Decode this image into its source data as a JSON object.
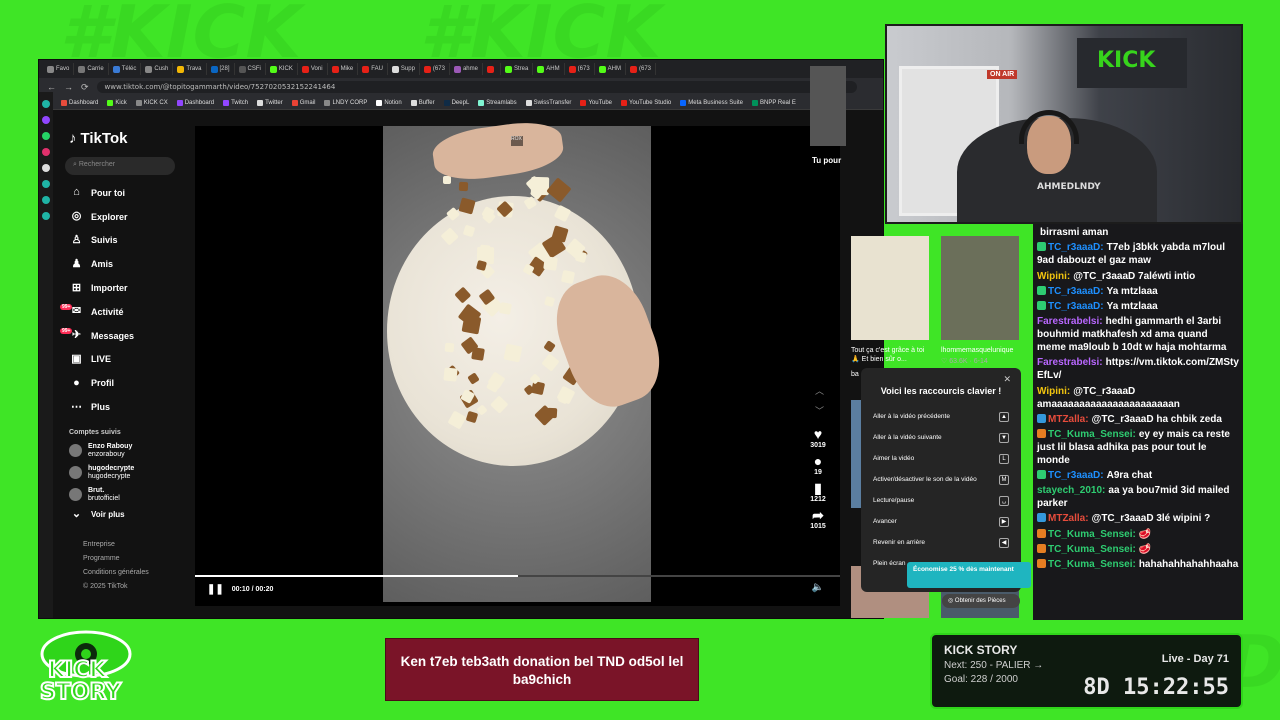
{
  "browser": {
    "tabs": [
      {
        "label": "Favo",
        "color": "#888888"
      },
      {
        "label": "Carrie",
        "color": "#777777"
      },
      {
        "label": "Téléc",
        "color": "#3a7bd5"
      },
      {
        "label": "Cush",
        "color": "#888888"
      },
      {
        "label": "Trava",
        "color": "#f2b705"
      },
      {
        "label": "[28]",
        "color": "#0a66c2"
      },
      {
        "label": "CSFi",
        "color": "#555555"
      },
      {
        "label": "KICK",
        "color": "#53fc18"
      },
      {
        "label": "Voni",
        "color": "#e62117"
      },
      {
        "label": "Mike",
        "color": "#e62117"
      },
      {
        "label": "FAU",
        "color": "#e62117"
      },
      {
        "label": "Supp",
        "color": "#dddddd"
      },
      {
        "label": "(673",
        "color": "#e62117"
      },
      {
        "label": "ahme",
        "color": "#9b59b6"
      },
      {
        "label": "",
        "color": "#e62117"
      },
      {
        "label": "Strea",
        "color": "#53fc18"
      },
      {
        "label": "AHM",
        "color": "#53fc18"
      },
      {
        "label": "(673",
        "color": "#e62117"
      },
      {
        "label": "AHM",
        "color": "#53fc18"
      },
      {
        "label": "(673",
        "color": "#e62117"
      }
    ],
    "url": "www.tiktok.com/@topitogammarth/video/7527020532152241464",
    "bookmarks": [
      {
        "label": "Dashboard",
        "color": "#e74c3c"
      },
      {
        "label": "Kick",
        "color": "#53fc18"
      },
      {
        "label": "KICK CX",
        "color": "#888888"
      },
      {
        "label": "Dashboard",
        "color": "#9146ff"
      },
      {
        "label": "Twitch",
        "color": "#9146ff"
      },
      {
        "label": "Twitter",
        "color": "#dddddd"
      },
      {
        "label": "Gmail",
        "color": "#ea4335"
      },
      {
        "label": "LNDY CORP",
        "color": "#888888"
      },
      {
        "label": "Notion",
        "color": "#ffffff"
      },
      {
        "label": "Buffer",
        "color": "#dddddd"
      },
      {
        "label": "DeepL",
        "color": "#0f2b46"
      },
      {
        "label": "Streamlabs",
        "color": "#80f5d2"
      },
      {
        "label": "SwissTransfer",
        "color": "#dddddd"
      },
      {
        "label": "YouTube",
        "color": "#e62117"
      },
      {
        "label": "YouTube Studio",
        "color": "#e62117"
      },
      {
        "label": "Meta Business Suite",
        "color": "#0866ff"
      },
      {
        "label": "BNPP Real E",
        "color": "#00915a"
      }
    ]
  },
  "tiktok": {
    "logo": "TikTok",
    "search_placeholder": "Rechercher",
    "nav": [
      {
        "label": "Pour toi",
        "icon": "home-icon",
        "glyph": "⌂"
      },
      {
        "label": "Explorer",
        "icon": "compass-icon",
        "glyph": "◎"
      },
      {
        "label": "Suivis",
        "icon": "following-icon",
        "glyph": "♙"
      },
      {
        "label": "Amis",
        "icon": "friends-icon",
        "glyph": "♟"
      },
      {
        "label": "Importer",
        "icon": "upload-icon",
        "glyph": "⊞"
      },
      {
        "label": "Activité",
        "icon": "activity-icon",
        "glyph": "✉"
      },
      {
        "label": "Messages",
        "icon": "messages-icon",
        "glyph": "✈"
      },
      {
        "label": "LIVE",
        "icon": "live-icon",
        "glyph": "▣"
      },
      {
        "label": "Profil",
        "icon": "profile-icon",
        "glyph": "●"
      },
      {
        "label": "Plus",
        "icon": "more-icon",
        "glyph": "⋯"
      }
    ],
    "badge_activity": "99+",
    "badge_messages": "99+",
    "following_title": "Comptes suivis",
    "following": [
      {
        "name": "Enzo Rabouy",
        "handle": "enzorabouy"
      },
      {
        "name": "hugodecrypte",
        "handle": "hugodecrypte"
      },
      {
        "name": "Brut.",
        "handle": "brutofficiel"
      }
    ],
    "see_more": "Voir plus",
    "footer": [
      "Entreprise",
      "Programme",
      "Conditions générales",
      "© 2025 TikTok"
    ],
    "video": {
      "watermark": "ROX",
      "likes": "3019",
      "comments": "19",
      "saves": "1212",
      "shares": "1015",
      "time": "00:10 / 00:20",
      "progress": 0.5
    },
    "for_you_title": "Tu pour",
    "suggestions": [
      {
        "caption": "Tout ça c'est grâce à toi 🙏 Et bien sûr o...",
        "extra": "ba"
      },
      {
        "caption": "lhommemasquelunique",
        "stats": "♡ 63.6K · 6-14"
      }
    ],
    "shortcuts": {
      "title": "Voici les raccourcis clavier !",
      "items": [
        {
          "label": "Aller à la vidéo précédente",
          "key": "▲"
        },
        {
          "label": "Aller à la vidéo suivante",
          "key": "▼"
        },
        {
          "label": "Aimer la vidéo",
          "key": "L"
        },
        {
          "label": "Activer/désactiver le son de la vidéo",
          "key": "M"
        },
        {
          "label": "Lecture/pause",
          "key": "␣"
        },
        {
          "label": "Avancer",
          "key": "▶"
        },
        {
          "label": "Revenir en arrière",
          "key": "◀"
        },
        {
          "label": "Plein écran",
          "key": ""
        }
      ]
    },
    "promo": "Économise 25 % dès maintenant",
    "pieces_button": "Obtenir des Pièces"
  },
  "chat": {
    "messages": [
      {
        "user": "",
        "text": "birrasmi aman",
        "color": "#ffffff",
        "badge": ""
      },
      {
        "user": "TC_r3aaaD:",
        "text": "T7eb j3bkk yabda m7loul 9ad dabouzt el gaz maw",
        "color": "#1e90ff",
        "badge": "#2ecc71"
      },
      {
        "user": "Wipini:",
        "text": "@TC_r3aaaD 7aléwti intio",
        "color": "#f1c40f",
        "badge": ""
      },
      {
        "user": "TC_r3aaaD:",
        "text": "Ya mtzlaaa",
        "color": "#1e90ff",
        "badge": "#2ecc71"
      },
      {
        "user": "TC_r3aaaD:",
        "text": "Ya mtzlaaa",
        "color": "#1e90ff",
        "badge": "#2ecc71"
      },
      {
        "user": "Farestrabelsi:",
        "text": "hedhi gammarth el 3arbi bouhmid matkhafesh xd ama quand meme ma9loub b 10dt w haja mohtarma",
        "color": "#b967ff",
        "badge": ""
      },
      {
        "user": "Farestrabelsi:",
        "text": "https://vm.tiktok.com/ZMStyEfLv/",
        "color": "#b967ff",
        "badge": ""
      },
      {
        "user": "Wipini:",
        "text": "@TC_r3aaaD amaaaaaaaaaaaaaaaaaaaaaan",
        "color": "#f1c40f",
        "badge": ""
      },
      {
        "user": "MTZalla:",
        "text": "@TC_r3aaaD ha chbik zeda",
        "color": "#e74c3c",
        "badge": "#3498db"
      },
      {
        "user": "TC_Kuma_Sensei:",
        "text": "ey ey mais ca reste just lil blasa adhika pas pour tout le monde",
        "color": "#2ecc71",
        "badge": "#e67e22"
      },
      {
        "user": "TC_r3aaaD:",
        "text": "A9ra chat",
        "color": "#1e90ff",
        "badge": "#2ecc71"
      },
      {
        "user": "stayech_2010:",
        "text": "aa ya bou7mid 3id mailed parker",
        "color": "#2ecc71",
        "badge": ""
      },
      {
        "user": "MTZalla:",
        "text": "@TC_r3aaaD 3lé wipini ?",
        "color": "#e74c3c",
        "badge": "#3498db"
      },
      {
        "user": "TC_Kuma_Sensei:",
        "text": "🥩",
        "color": "#2ecc71",
        "badge": "#e67e22"
      },
      {
        "user": "TC_Kuma_Sensei:",
        "text": "🥩",
        "color": "#2ecc71",
        "badge": "#e67e22"
      },
      {
        "user": "TC_Kuma_Sensei:",
        "text": "hahahahhahahhaaha",
        "color": "#2ecc71",
        "badge": "#e67e22"
      }
    ]
  },
  "donation_text": "Ken t7eb teb3ath donation bel TND od5ol lel ba9chich",
  "webcam": {
    "banner_text": "KICK",
    "on_air": "ON AIR",
    "shirt_text": "AHMEDLNDY"
  },
  "story_logo": {
    "line1": "KICK",
    "line2": "STORY"
  },
  "kick_story": {
    "title": "KICK STORY",
    "next": "Next: 250 - PALIER →",
    "goal": "Goal: 228 / 2000",
    "day": "Live - Day 71",
    "timer_days": "8D",
    "timer": "15:22:55"
  },
  "background_words": [
    "#KICK",
    "#KICK",
    "LNDY"
  ],
  "colors": {
    "green_screen": "#3fe526",
    "kick_green": "#53fc18",
    "chat_bg": "#18181b",
    "donation_bg": "#7a1428"
  }
}
